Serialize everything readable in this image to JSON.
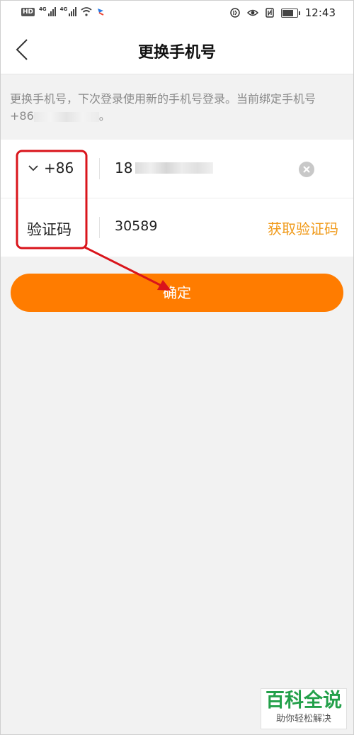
{
  "status_bar": {
    "time": "12:43",
    "network_left": "4G",
    "network_right": "4G",
    "hd_badge": "HD"
  },
  "nav": {
    "title": "更换手机号",
    "back_icon": "chevron-left-icon"
  },
  "description": {
    "text": "更换手机号，下次登录使用新的手机号登录。当前绑定手机号 +86",
    "suffix": "。"
  },
  "form": {
    "country_code": "+86",
    "phone_prefix": "18",
    "code_label": "验证码",
    "code_value": "30589",
    "get_code_label": "获取验证码"
  },
  "confirm_label": "确定",
  "colors": {
    "accent": "#ff7c00",
    "get_code": "#f09a1a",
    "annotation": "#d9141b"
  },
  "watermark": {
    "title": "百科全说",
    "subtitle": "助你轻松解决"
  }
}
